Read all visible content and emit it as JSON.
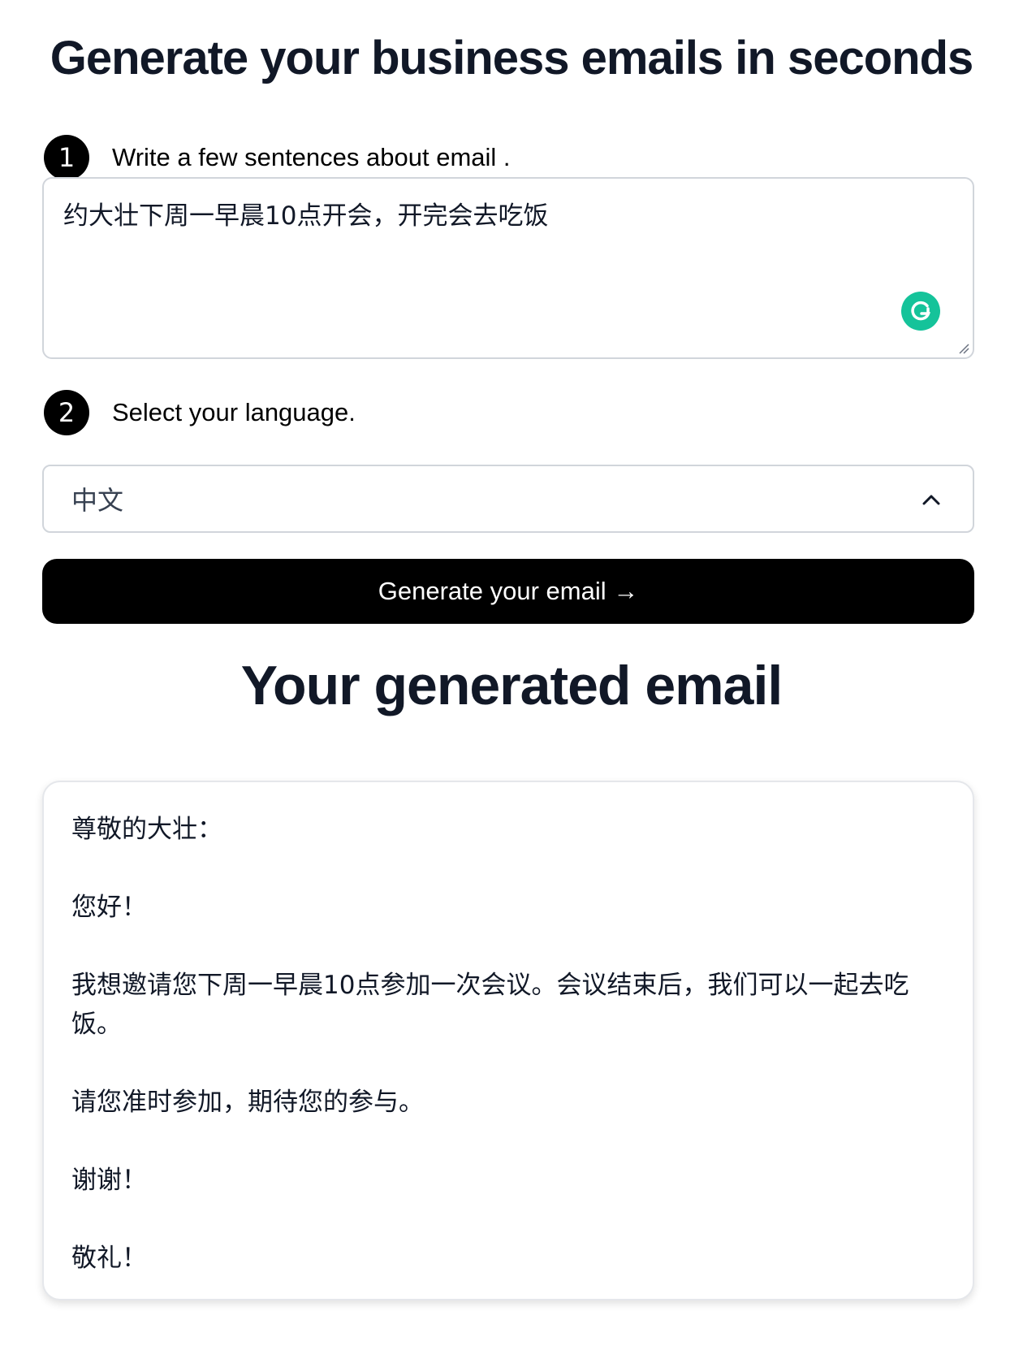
{
  "header": {
    "title": "Generate your business emails in seconds"
  },
  "step1": {
    "number": "1",
    "label": "Write a few sentences about email ."
  },
  "textarea": {
    "value": "约大壮下周一早晨10点开会，开完会去吃饭"
  },
  "step2": {
    "number": "2",
    "label": "Select your language."
  },
  "language_select": {
    "value": "中文"
  },
  "generate_button": {
    "label": "Generate your email →"
  },
  "result": {
    "title": "Your generated email",
    "lines": [
      "尊敬的大壮：",
      "您好！",
      "我想邀请您下周一早晨10点参加一次会议。会议结束后，我们可以一起去吃饭。",
      "请您准时参加，期待您的参与。",
      "谢谢！",
      "敬礼！"
    ]
  },
  "colors": {
    "accent": "#000000",
    "grammarly": "#15c39a",
    "title": "#111827"
  }
}
